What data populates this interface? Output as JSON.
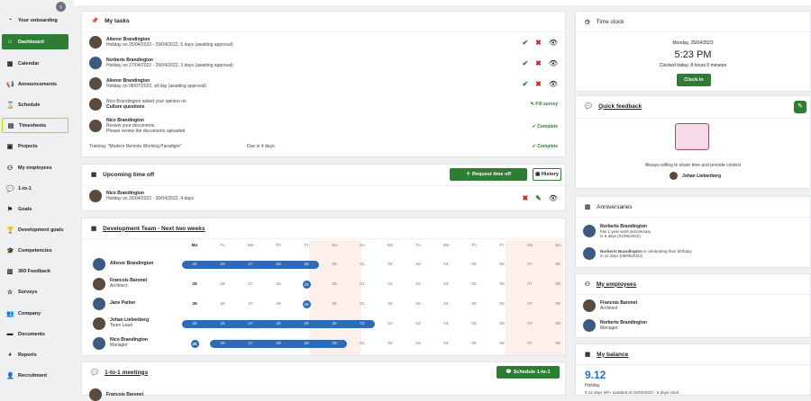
{
  "sidebar": {
    "items": [
      {
        "label": "Your onboarding",
        "icon": "speedometer-icon"
      },
      {
        "label": "Dashboard",
        "icon": "home-icon"
      },
      {
        "label": "Calendar",
        "icon": "calendar-icon"
      },
      {
        "label": "Announcements",
        "icon": "megaphone-icon"
      },
      {
        "label": "Schedule",
        "icon": "hourglass-icon"
      },
      {
        "label": "Timesheets",
        "icon": "timesheet-icon"
      },
      {
        "label": "Projects",
        "icon": "briefcase-icon"
      },
      {
        "label": "My employees",
        "icon": "org-chart-icon"
      },
      {
        "label": "1-to-1",
        "icon": "chat-icon"
      },
      {
        "label": "Goals",
        "icon": "flag-icon"
      },
      {
        "label": "Development goals",
        "icon": "trophy-icon"
      },
      {
        "label": "Competencies",
        "icon": "cap-icon"
      },
      {
        "label": "360 Feedback",
        "icon": "document-icon"
      },
      {
        "label": "Surveys",
        "icon": "star-icon"
      },
      {
        "label": "Company",
        "icon": "people-icon"
      },
      {
        "label": "Documents",
        "icon": "folder-icon"
      },
      {
        "label": "Reports",
        "icon": "pie-icon"
      },
      {
        "label": "Recruitment",
        "icon": "add-person-icon"
      }
    ]
  },
  "tasks": {
    "title": "My tasks",
    "items": [
      {
        "name": "Alienor Brandington",
        "detail": "Holiday on 25/04/2022 - 29/04/2022, 5 days (awaiting approval)"
      },
      {
        "name": "Norberts Brandington",
        "detail": "Holiday on 27/04/2022 - 29/04/2022, 3 days (awaiting approval)"
      },
      {
        "name": "Alienor Brandington",
        "detail": "Holiday on 08/07/2022, all day (awaiting approval)"
      }
    ],
    "survey": {
      "line1": "Nico Brandington asked your opinion on",
      "line2": "Culture questions",
      "action": "Fill survey"
    },
    "docs": {
      "name": "Nico Brandington",
      "line1": "Review your documents",
      "line2": "Please review the documents uploaded",
      "action": "Complete"
    },
    "training": {
      "label": "Training: \"Modern Remote Working Paradigm\"",
      "due": "Due in 4 days",
      "action": "Complete"
    }
  },
  "timeoff": {
    "title": "Upcoming time off",
    "request": "Request time off",
    "history": "History",
    "name": "Nico Brandington",
    "detail": "Holiday on 26/04/2022 - 30/04/2022, 4 days"
  },
  "dev": {
    "title": "Development Team - Next two weeks",
    "days": [
      "Mo",
      "Tu",
      "We",
      "Th",
      "Fr",
      "Sa",
      "Su",
      "Mo",
      "Tu",
      "We",
      "Th",
      "Fr",
      "Sa",
      "Su"
    ],
    "dates": [
      "25",
      "26",
      "27",
      "28",
      "29",
      "30",
      "01",
      "02",
      "03",
      "04",
      "05",
      "06",
      "07",
      "08"
    ],
    "members": [
      {
        "name": "Alienor Brandington",
        "role": ""
      },
      {
        "name": "Francois Baronet",
        "role": "Architect"
      },
      {
        "name": "Jane Parker",
        "role": ""
      },
      {
        "name": "Johan Liebenberg",
        "role": "Team Lead"
      },
      {
        "name": "Nico Brandington",
        "role": "Manager"
      }
    ]
  },
  "meetings": {
    "title": "1-to-1 meetings",
    "button": "Schedule 1-to-1",
    "first": "Francois Baronet"
  },
  "clock": {
    "title": "Time clock",
    "date": "Monday, 25/04/2022",
    "time": "5:23 PM",
    "today": "Clocked today: 8 hours 0 minutes",
    "button": "Clock in"
  },
  "feedback": {
    "title": "Quick feedback",
    "text": "Always willing to share time and provide context",
    "author": "Johan Liebenberg"
  },
  "anniv": {
    "title": "Anniversaries",
    "items": [
      {
        "name": "Norberts Brandington",
        "l1": "has 1 year work anniversary",
        "l2": "in 6 days (01/05/2022)"
      },
      {
        "name": "Norberts Brandington",
        "l1": "is celebrating their birthday",
        "l2": "in 14 days (09/05/2022)"
      }
    ]
  },
  "myemp": {
    "title": "My employees",
    "items": [
      {
        "name": "Francois Baronet",
        "role": "Architect"
      },
      {
        "name": "Norberts Brandington",
        "role": "Manager"
      }
    ]
  },
  "balance": {
    "title": "My balance",
    "value": "9.12",
    "label": "Holiday",
    "note": "9.12 days left • updated at 22/04/2022 - 6 days used"
  },
  "colors": {
    "green": "#2e7d32",
    "blue": "#2e6bb5",
    "red": "#c62828"
  }
}
